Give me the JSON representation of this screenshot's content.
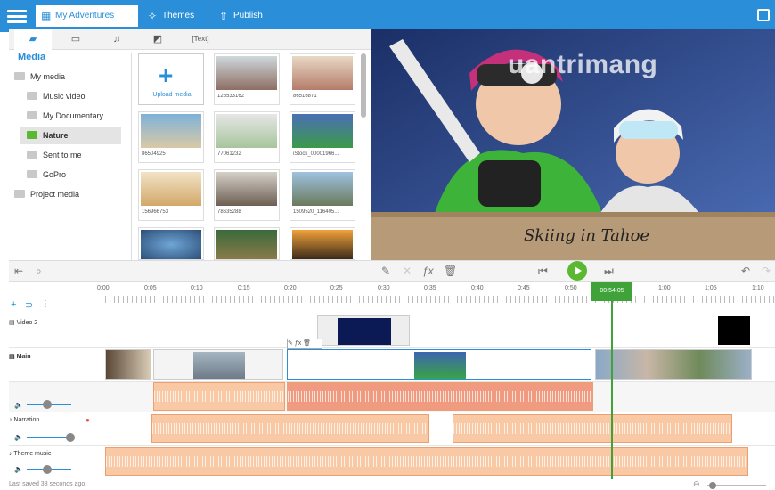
{
  "topbar": {
    "tabs": [
      {
        "label": "My Adventures",
        "icon": "film-icon"
      },
      {
        "label": "Themes",
        "icon": "magic-wand-icon"
      },
      {
        "label": "Publish",
        "icon": "upload-icon"
      }
    ]
  },
  "media_tabs": [
    "folder-icon",
    "slides-icon",
    "music-icon",
    "transition-icon",
    "Text"
  ],
  "media": {
    "title": "Media",
    "tree": [
      "My media",
      "Music video",
      "My Documentary",
      "Nature",
      "Sent to me",
      "GoPro",
      "Project media"
    ],
    "selected": "Nature",
    "upload_label": "Upload media",
    "thumbs": [
      "126533162",
      "86516871",
      "86504925",
      "77061232",
      "iStock_00001966...",
      "156966753",
      "78635288",
      "1509520_116405..."
    ]
  },
  "preview": {
    "watermark": "uantrimang",
    "caption": "Skiing in Tahoe"
  },
  "timeline": {
    "ticks": [
      "0:00",
      "0:05",
      "0:10",
      "0:15",
      "0:20",
      "0:25",
      "0:30",
      "0:35",
      "0:40",
      "0:45",
      "0:50",
      "1:00",
      "1:05",
      "1:10"
    ],
    "playhead": "00:54:05",
    "tracks": [
      "Video 2",
      "Main",
      "Narration",
      "Theme music"
    ]
  },
  "status": {
    "saved": "Last saved 38 seconds ago."
  },
  "colors": {
    "accent": "#2a8fd8",
    "playhead": "#3fa33a",
    "audio": "#f8c9a4"
  }
}
